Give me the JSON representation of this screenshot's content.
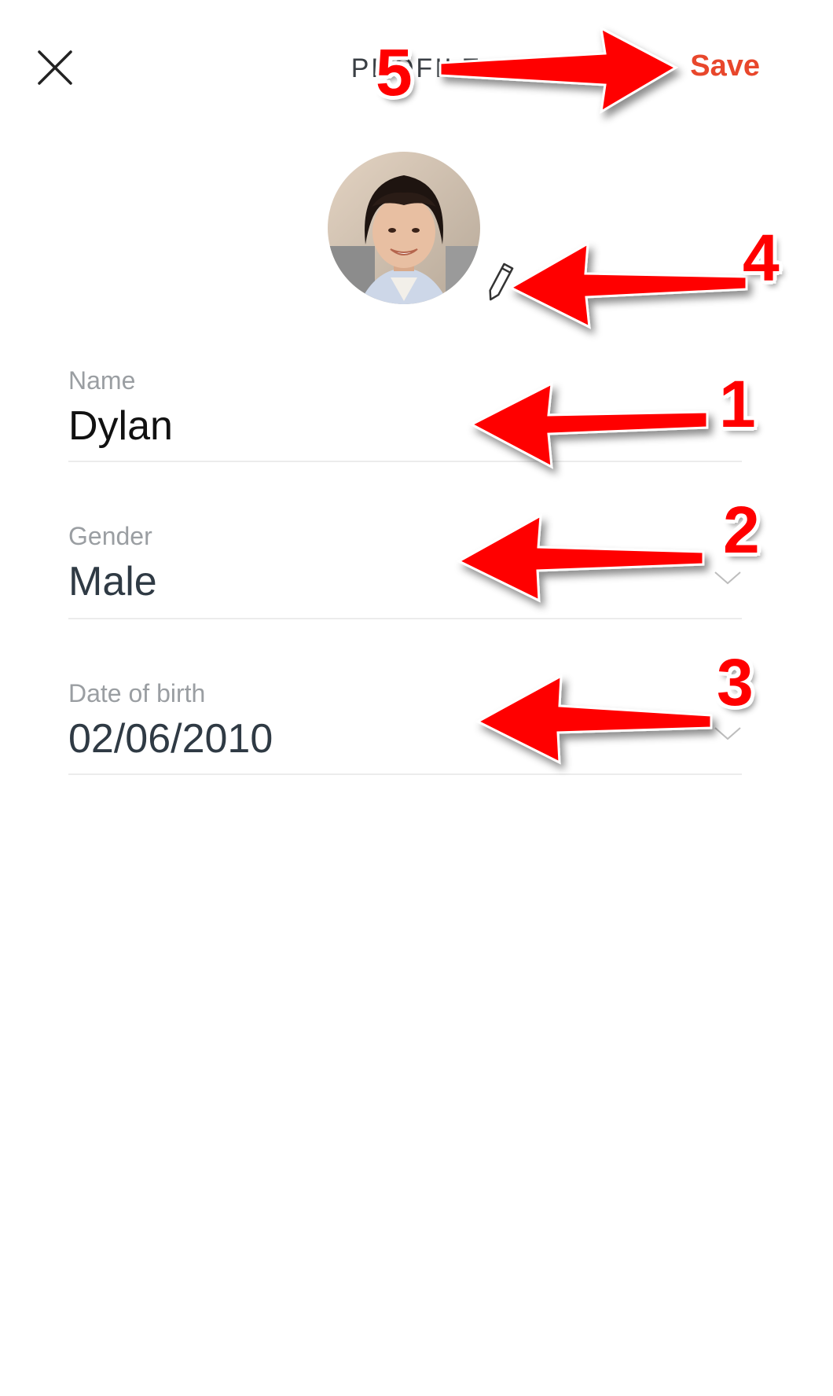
{
  "header": {
    "title": "PROFILE",
    "save_label": "Save",
    "close_icon": "close-icon"
  },
  "avatar": {
    "icon": "avatar",
    "edit_icon": "pencil-icon"
  },
  "fields": {
    "name": {
      "label": "Name",
      "value": "Dylan"
    },
    "gender": {
      "label": "Gender",
      "value": "Male"
    },
    "dob": {
      "label": "Date of birth",
      "value": "02/06/2010"
    }
  },
  "annotations": {
    "n1": "1",
    "n2": "2",
    "n3": "3",
    "n4": "4",
    "n5": "5"
  },
  "colors": {
    "accent": "#e8472c",
    "annotation": "#ff0000",
    "divider": "#ececec"
  }
}
